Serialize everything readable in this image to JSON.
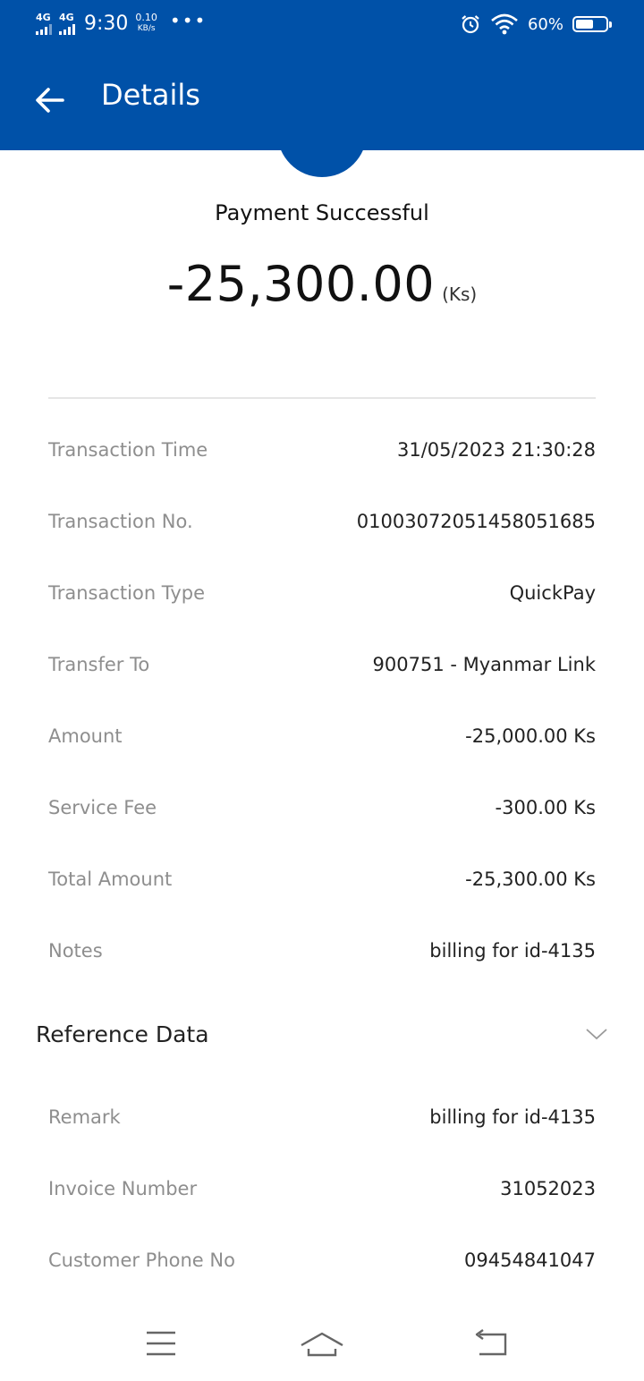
{
  "status_bar": {
    "net1": "4G",
    "net2": "4G",
    "time": "9:30",
    "speed_value": "0.10",
    "speed_unit": "KB/s",
    "dots": "•••",
    "battery_percent": "60%",
    "battery_level": 0.6
  },
  "app_bar": {
    "title": "Details",
    "back_icon": "arrow-left-icon"
  },
  "colors": {
    "brand_blue": "#0051A8",
    "label_gray": "#8e8e8e"
  },
  "summary": {
    "status": "Payment Successful",
    "amount": "-25,300.00",
    "currency": "(Ks)"
  },
  "details": [
    {
      "label": "Transaction Time",
      "value": "31/05/2023 21:30:28"
    },
    {
      "label": "Transaction No.",
      "value": "01003072051458051685"
    },
    {
      "label": "Transaction Type",
      "value": "QuickPay"
    },
    {
      "label": "Transfer To",
      "value": "900751 - Myanmar Link"
    },
    {
      "label": "Amount",
      "value": "-25,000.00 Ks"
    },
    {
      "label": "Service Fee",
      "value": "-300.00 Ks"
    },
    {
      "label": "Total Amount",
      "value": "-25,300.00 Ks"
    },
    {
      "label": "Notes",
      "value": "billing for id-4135"
    }
  ],
  "reference": {
    "title": "Reference Data",
    "toggle_icon": "chevron-down-icon",
    "items": [
      {
        "label": "Remark",
        "value": "billing for id-4135"
      },
      {
        "label": "Invoice Number",
        "value": "31052023"
      },
      {
        "label": "Customer Phone No",
        "value": "09454841047"
      }
    ]
  },
  "nav_bar": {
    "icons": [
      "menu-icon",
      "home-icon",
      "back-icon"
    ]
  }
}
